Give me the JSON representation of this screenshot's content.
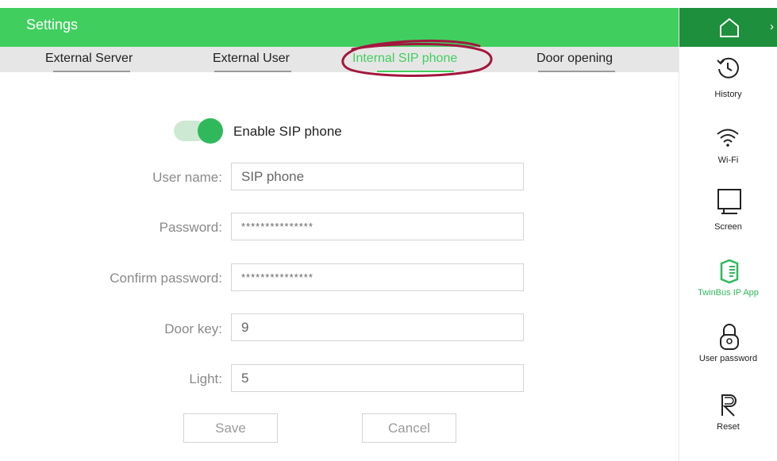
{
  "app": {
    "title": "Settings"
  },
  "tabs": [
    {
      "label": "External Server",
      "active": false
    },
    {
      "label": "External User",
      "active": false
    },
    {
      "label": "Internal SIP phone",
      "active": true
    },
    {
      "label": "Door opening",
      "active": false
    }
  ],
  "sip": {
    "toggle_label": "Enable SIP phone",
    "enabled": true
  },
  "form": {
    "user_name": {
      "label": "User name:",
      "value": "SIP phone"
    },
    "password": {
      "label": "Password:",
      "value": "***************"
    },
    "confirm_password": {
      "label": "Confirm password:",
      "value": "***************"
    },
    "door_key": {
      "label": "Door key:",
      "value": "9"
    },
    "light": {
      "label": "Light:",
      "value": "5"
    }
  },
  "buttons": {
    "save": "Save",
    "cancel": "Cancel"
  },
  "sidebar": {
    "items": [
      {
        "label": "History",
        "icon": "history-icon"
      },
      {
        "label": "Wi-Fi",
        "icon": "wifi-icon"
      },
      {
        "label": "Screen",
        "icon": "screen-icon"
      },
      {
        "label": "TwinBus IP App",
        "icon": "twinbus-app-icon",
        "active": true
      },
      {
        "label": "User password",
        "icon": "lock-icon"
      },
      {
        "label": "Reset",
        "icon": "reset-icon"
      }
    ]
  },
  "colors": {
    "brand_green": "#40cf5f",
    "dark_green": "#1e8f3c",
    "annotation_red": "#a3173f"
  }
}
